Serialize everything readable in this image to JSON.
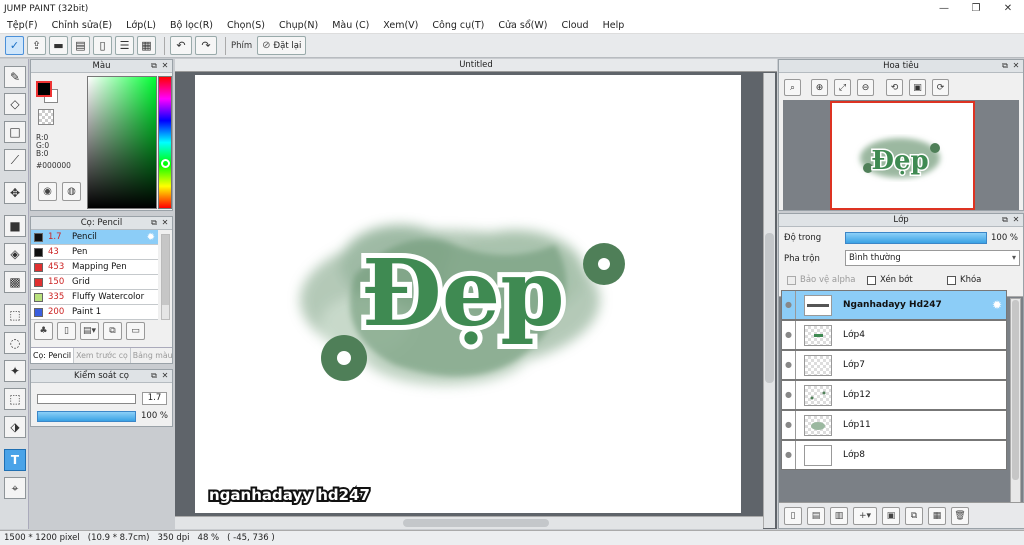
{
  "window": {
    "title": "JUMP PAINT (32bit)",
    "minimize": "—",
    "restore": "❐",
    "close": "✕"
  },
  "menu": [
    "Tệp(F)",
    "Chỉnh sửa(E)",
    "Lớp(L)",
    "Bộ lọc(R)",
    "Chọn(S)",
    "Chụp(N)",
    "Màu (C)",
    "Xem(V)",
    "Công cụ(T)",
    "Cửa sổ(W)",
    "Cloud",
    "Help"
  ],
  "toolbar": {
    "key_label": "Phím",
    "reset_label": "Đặt lại"
  },
  "color_panel": {
    "title": "Màu",
    "r": "R:0",
    "g": "G:0",
    "b": "B:0",
    "hex": "#000000",
    "fg": "#000000",
    "bg": "#ffffff"
  },
  "brush_panel": {
    "title": "Cọ: Pencil",
    "brushes": [
      {
        "size": "1.7",
        "name": "Pencil",
        "color": "#111111"
      },
      {
        "size": "43",
        "name": "Pen",
        "color": "#111111"
      },
      {
        "size": "453",
        "name": "Mapping Pen",
        "color": "#e03030"
      },
      {
        "size": "150",
        "name": "Grid",
        "color": "#e03030"
      },
      {
        "size": "335",
        "name": "Fluffy Watercolor",
        "color": "#b9e27d"
      },
      {
        "size": "200",
        "name": "Paint 1",
        "color": "#3a5fe0"
      }
    ],
    "tabs": [
      "Cọ: Pencil",
      "Xem trước cọ",
      "Bảng màu"
    ]
  },
  "control_panel": {
    "title": "Kiểm soát cọ",
    "size_value": "1.7",
    "opacity_value": "100 %"
  },
  "document": {
    "tab_title": "Untitled",
    "wordmark": "Đẹp",
    "watermark": "nganhadayy hd247"
  },
  "navigator": {
    "title": "Hoa tiêu"
  },
  "layer_panel": {
    "title": "Lớp",
    "opacity_label": "Độ trong",
    "opacity_value": "100 %",
    "blend_label": "Pha trộn",
    "blend_value": "Bình thường",
    "protect_alpha": "Bảo vệ alpha",
    "clipping": "Xén bớt",
    "lock": "Khóa",
    "layers": [
      "Nganhadayy Hd247",
      "Lớp4",
      "Lớp7",
      "Lớp12",
      "Lớp11",
      "Lớp8"
    ]
  },
  "status": {
    "size": "1500 * 1200 pixel",
    "dims": "(10.9 * 8.7cm)",
    "dpi": "350 dpi",
    "zoom": "48 %",
    "coords": "( -45, 736 )"
  }
}
